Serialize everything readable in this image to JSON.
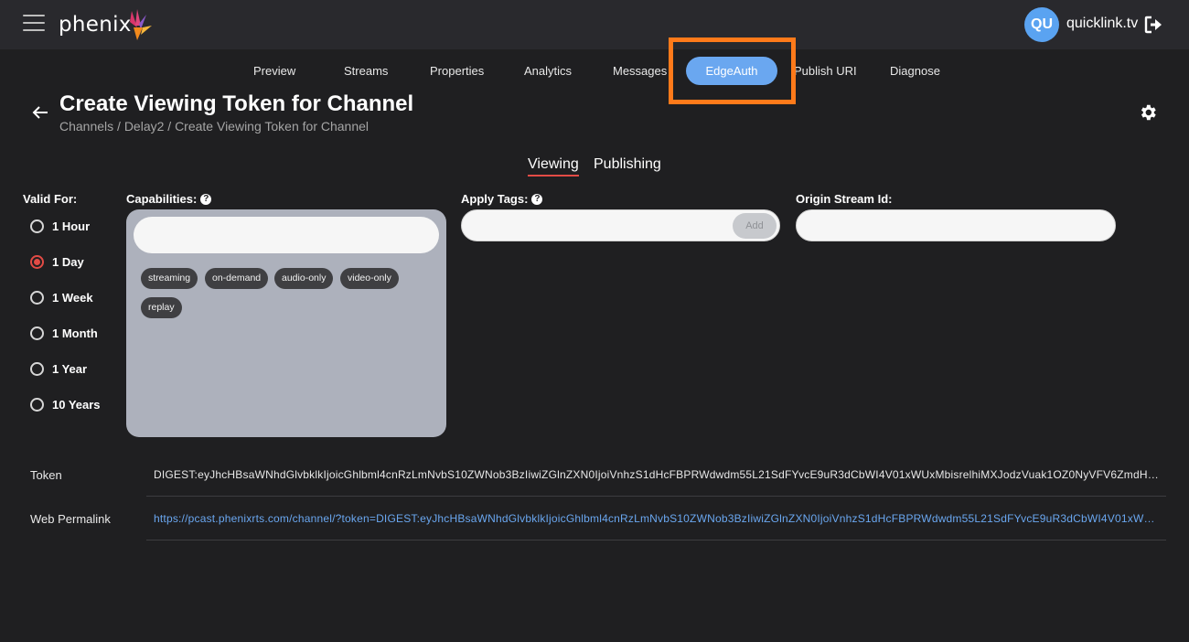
{
  "header": {
    "logo_text": "phenix",
    "account": {
      "initials": "QU",
      "name": "quicklink.tv"
    },
    "icons": {
      "menu": "hamburger-menu-icon",
      "logout": "logout-icon"
    }
  },
  "nav": {
    "tabs": [
      {
        "label": "Preview"
      },
      {
        "label": "Streams"
      },
      {
        "label": "Properties"
      },
      {
        "label": "Analytics"
      },
      {
        "label": "Messages"
      },
      {
        "label": "EdgeAuth",
        "active": true
      },
      {
        "label": "Publish URI"
      },
      {
        "label": "Diagnose"
      }
    ]
  },
  "page": {
    "title": "Create Viewing Token for Channel",
    "breadcrumb": "Channels / Delay2 / Create Viewing Token for Channel",
    "subtabs": [
      {
        "label": "Viewing",
        "active": true
      },
      {
        "label": "Publishing"
      }
    ]
  },
  "form": {
    "valid_for": {
      "label": "Valid For:",
      "options": [
        "1 Hour",
        "1 Day",
        "1 Week",
        "1 Month",
        "1 Year",
        "10 Years"
      ],
      "selected": "1 Day"
    },
    "capabilities": {
      "label": "Capabilities:",
      "input_value": "",
      "chips": [
        "streaming",
        "on-demand",
        "audio-only",
        "video-only",
        "replay"
      ]
    },
    "apply_tags": {
      "label": "Apply Tags:",
      "input_value": "",
      "add_label": "Add"
    },
    "origin_stream": {
      "label": "Origin Stream Id:",
      "input_value": ""
    }
  },
  "results": {
    "token_label": "Token",
    "token_value": "DIGEST:eyJhcHBsaWNhdGlvbklkIjoicGhlbml4cnRzLmNvbS10ZWNob3BzIiwiZGlnZXN0IjoiVnhzS1dHcFBPRWdwdm55L21SdFYvcE9uR3dCbWI4V01xWUxMbisrelhiMXJodzVuak1OZ0NyVFV6ZmdHcTBrNFFZUmVZaE10Q1dDeFdnZ2xZZz09IiwidG9rZW4iOiJ7XCJleHBpcmVzXCI6MTY5MDgzNTQ3NzU3N31",
    "permalink_label": "Web Permalink",
    "permalink_value": "https://pcast.phenixrts.com/channel/?token=DIGEST:eyJhcHBsaWNhdGlvbklkIjoicGhlbml4cnRzLmNvbS10ZWNob3BzIiwiZGlnZXN0IjoiVnhzS1dHcFBPRWdwdm55L21SdFYvcE9uR3dCbWI4V01xWUxMbisrelhiMXJodzVuak1OZ0NyVFV6ZmdHcTBrNFFZUmVZaE10Q1dDeFdnZ2xZZz09"
  },
  "colors": {
    "background": "#1f1f21",
    "topbar": "#29292d",
    "accent_blue": "#6aa7f0",
    "accent_red": "#e34b45",
    "highlight_orange": "#ff7a1a",
    "capabilities_panel": "#adb1bc"
  }
}
